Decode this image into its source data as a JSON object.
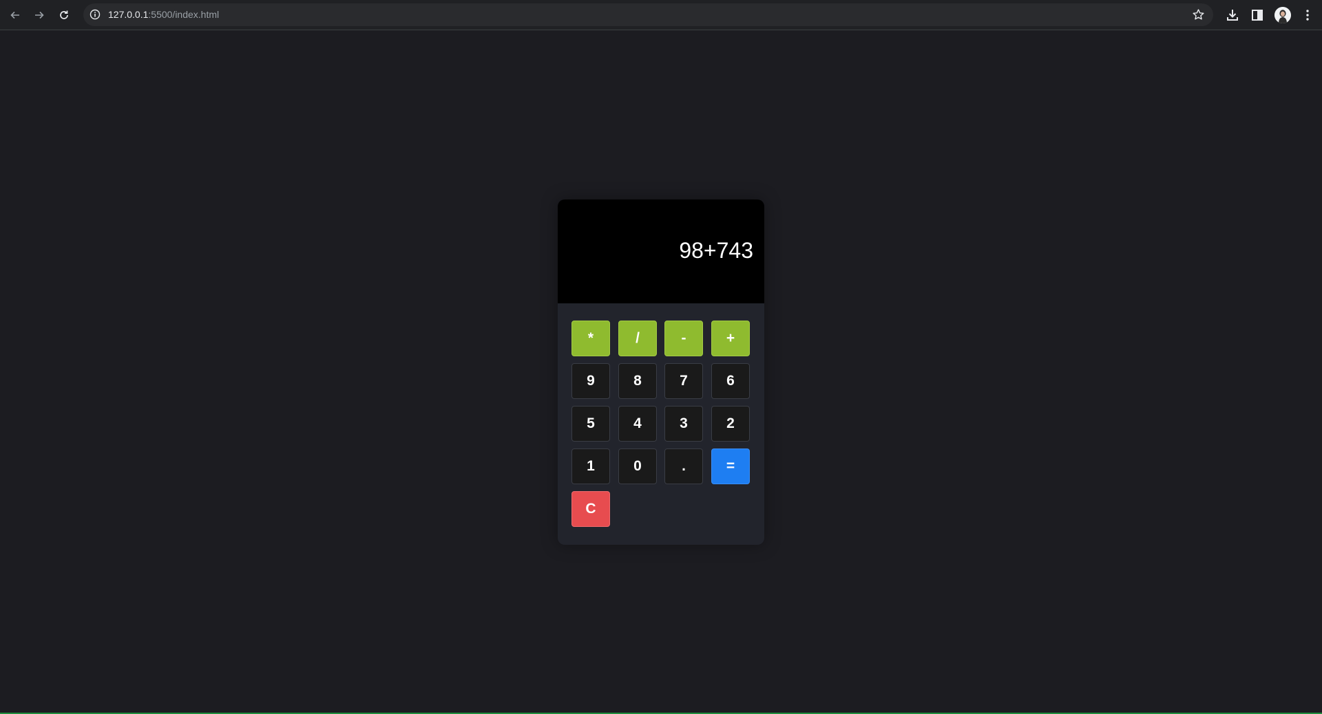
{
  "browser": {
    "url_host": "127.0.0.1",
    "url_path": ":5500/index.html",
    "icons": {
      "back": "arrow-left-icon",
      "forward": "arrow-right-icon",
      "reload": "reload-icon",
      "site_info": "info-icon",
      "bookmark": "star-icon",
      "downloads": "download-icon",
      "side_panel": "side-panel-icon",
      "profile": "avatar",
      "menu": "kebab-menu-icon"
    }
  },
  "calculator": {
    "display": "98+743",
    "colors": {
      "operator": "#8fbb2f",
      "equals": "#1e7ef2",
      "clear": "#e74c4f",
      "digit": "#1a1a1a",
      "display_bg": "#000000",
      "body_bg": "#22242c"
    },
    "keys": {
      "multiply": "*",
      "divide": "/",
      "subtract": "-",
      "add": "+",
      "nine": "9",
      "eight": "8",
      "seven": "7",
      "six": "6",
      "five": "5",
      "four": "4",
      "three": "3",
      "two": "2",
      "one": "1",
      "zero": "0",
      "decimal": ".",
      "equals": "=",
      "clear": "C"
    }
  }
}
